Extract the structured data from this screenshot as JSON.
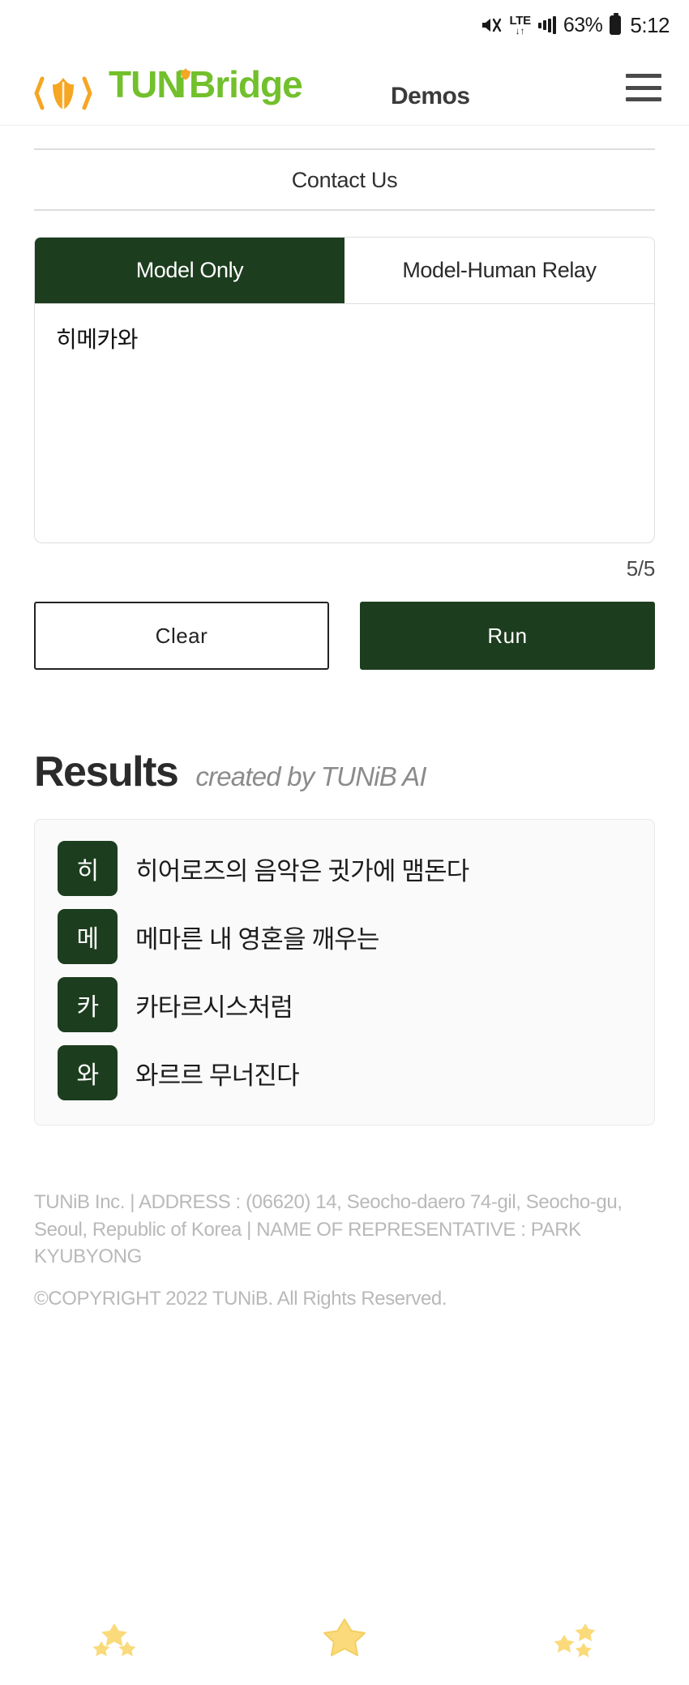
{
  "statusbar": {
    "mute_icon": "mute-icon",
    "network_label": "LTE",
    "network_arrows": "↓↑",
    "signal_icon": "signal-bars-icon",
    "battery_percent": "63%",
    "battery_icon": "battery-icon",
    "time": "5:12"
  },
  "header": {
    "logo_icon": "tulip-logo-icon",
    "logo_text": "TUNiBridge",
    "section_label": "Demos",
    "menu_icon": "hamburger-menu-icon"
  },
  "nav": {
    "contact_label": "Contact Us"
  },
  "tabs": [
    {
      "label": "Model Only",
      "active": true
    },
    {
      "label": "Model-Human Relay",
      "active": false
    }
  ],
  "input": {
    "value": "히메카와",
    "placeholder": "",
    "counter": "5/5"
  },
  "actions": {
    "clear_label": "Clear",
    "run_label": "Run"
  },
  "results": {
    "title": "Results",
    "subtitle": "created by TUNiB AI",
    "rows": [
      {
        "badge": "히",
        "text": "히어로즈의 음악은 귓가에 맴돈다"
      },
      {
        "badge": "메",
        "text": "메마른 내 영혼을 깨우는"
      },
      {
        "badge": "카",
        "text": "카타르시스처럼"
      },
      {
        "badge": "와",
        "text": "와르르 무너진다"
      }
    ]
  },
  "footer": {
    "company_line": "TUNiB Inc. | ADDRESS : (06620) 14, Seocho-daero 74-gil, Seocho-gu, Seoul, Republic of Korea | NAME OF REPRESENTATIVE : PARK KYUBYONG",
    "copyright": "©COPYRIGHT 2022 TUNiB. All Rights Reserved."
  },
  "bottomnav": [
    {
      "icon": "stars-back-icon"
    },
    {
      "icon": "star-home-icon"
    },
    {
      "icon": "stars-recent-icon"
    }
  ],
  "colors": {
    "brand_green": "#72c02c",
    "brand_orange": "#f5a623",
    "dark_green": "#1d3d1f",
    "star_yellow": "#fada7a"
  }
}
